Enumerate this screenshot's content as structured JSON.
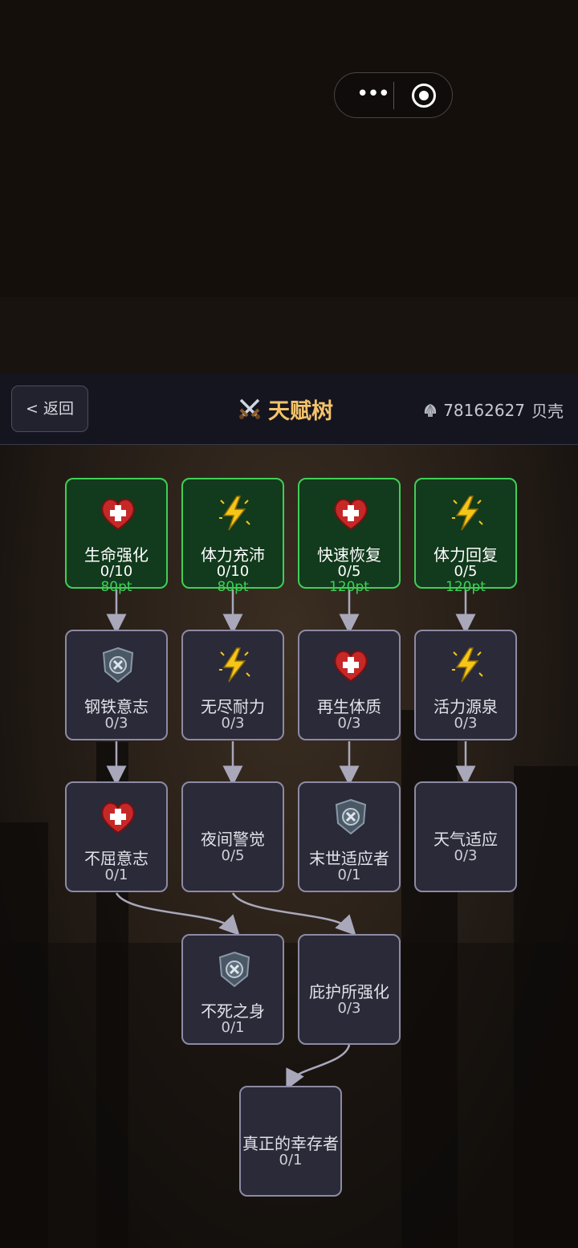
{
  "header": {
    "back_label": "< 返回",
    "title": "天赋树",
    "currency_amount": "78162627",
    "currency_unit": "贝壳"
  },
  "colors": {
    "accent": "#f3c36a",
    "unlocked_border": "#3fcf56",
    "locked_border": "#8d8aa4"
  },
  "talents": {
    "r1": [
      {
        "name": "生命强化",
        "level": "0/10",
        "cost": "80pt",
        "icon": "heart-icon"
      },
      {
        "name": "体力充沛",
        "level": "0/10",
        "cost": "80pt",
        "icon": "lightning-icon"
      },
      {
        "name": "快速恢复",
        "level": "0/5",
        "cost": "120pt",
        "icon": "heart-icon"
      },
      {
        "name": "体力回复",
        "level": "0/5",
        "cost": "120pt",
        "icon": "lightning-icon"
      }
    ],
    "r2": [
      {
        "name": "钢铁意志",
        "level": "0/3",
        "icon": "shield-icon"
      },
      {
        "name": "无尽耐力",
        "level": "0/3",
        "icon": "lightning-icon"
      },
      {
        "name": "再生体质",
        "level": "0/3",
        "icon": "heart-icon"
      },
      {
        "name": "活力源泉",
        "level": "0/3",
        "icon": "lightning-icon"
      }
    ],
    "r3": [
      {
        "name": "不屈意志",
        "level": "0/1",
        "icon": "heart-icon"
      },
      {
        "name": "夜间警觉",
        "level": "0/5"
      },
      {
        "name": "末世适应者",
        "level": "0/1",
        "icon": "shield-icon"
      },
      {
        "name": "天气适应",
        "level": "0/3"
      }
    ],
    "r4": [
      {
        "name": "不死之身",
        "level": "0/1",
        "icon": "shield-icon"
      },
      {
        "name": "庇护所强化",
        "level": "0/3"
      }
    ],
    "r5": [
      {
        "name": "真正的幸存者",
        "level": "0/1"
      }
    ]
  }
}
